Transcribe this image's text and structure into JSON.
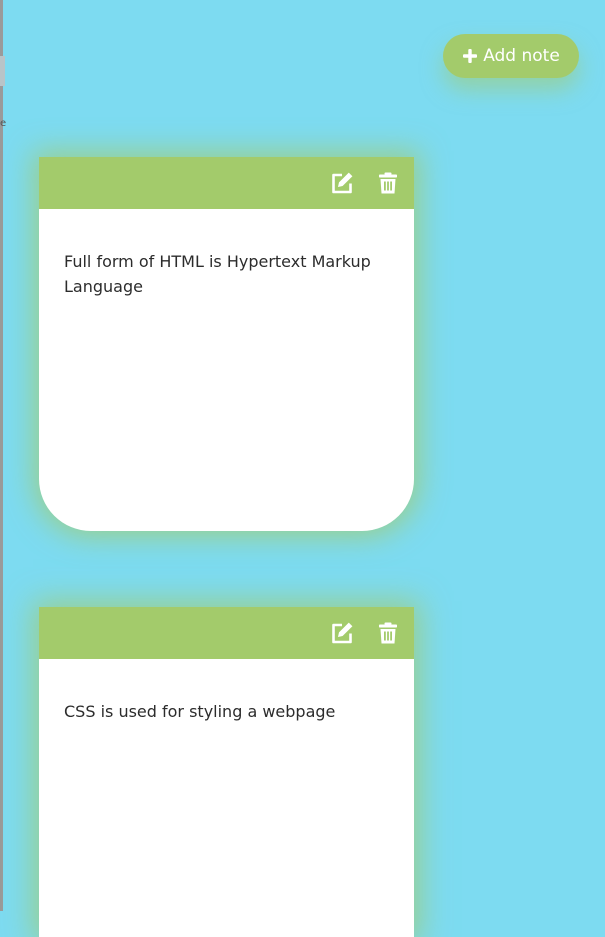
{
  "toolbar": {
    "add_note_label": "Add note",
    "add_note_icon": "plus-icon"
  },
  "colors": {
    "background": "#7DDBF1",
    "accent": "#A3CB6B",
    "note_body": "#FFFFFF",
    "text": "#2C2C2C"
  },
  "notes": [
    {
      "text": "Full form of HTML is Hypertext Markup Language",
      "edit_icon": "edit-icon",
      "delete_icon": "trash-icon"
    },
    {
      "text": "CSS is used for styling a webpage",
      "edit_icon": "edit-icon",
      "delete_icon": "trash-icon"
    }
  ]
}
